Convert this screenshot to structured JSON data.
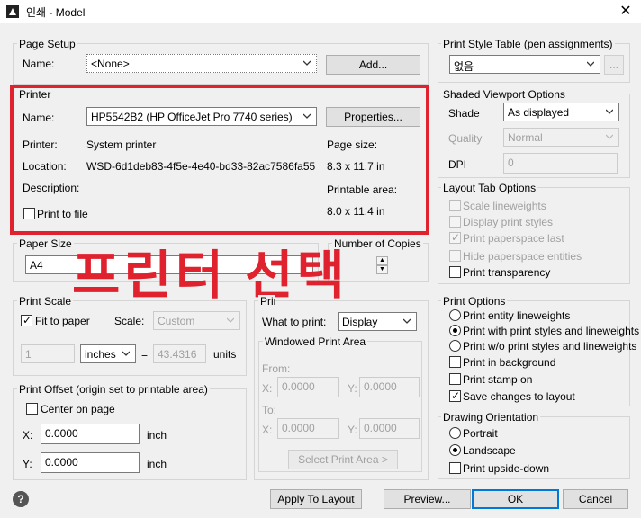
{
  "window": {
    "title": "인쇄 - Model",
    "close": "✕"
  },
  "page_setup": {
    "label": "Page Setup",
    "name_label": "Name:",
    "name_value": "<None>",
    "add_button": "Add..."
  },
  "printer": {
    "label": "Printer",
    "name_label": "Name:",
    "name_value": "HP5542B2 (HP OfficeJet Pro 7740 series)",
    "properties_button": "Properties...",
    "printer_label": "Printer:",
    "printer_value": "System printer",
    "location_label": "Location:",
    "location_value": "WSD-6d1deb83-4f5e-4e40-bd33-82ac7586fa55",
    "description_label": "Description:",
    "print_to_file": "Print to file",
    "page_size_label": "Page size:",
    "page_size_value": "8.3 x 11.7 in",
    "printable_area_label": "Printable area:",
    "printable_area_value": "8.0 x 11.4 in"
  },
  "annotation": "프린터 선택",
  "paper_size": {
    "label": "Paper Size",
    "value": "A4"
  },
  "copies": {
    "label": "Number of Copies"
  },
  "print_scale": {
    "label": "Print Scale",
    "fit_to_paper": "Fit to paper",
    "fit_checked": true,
    "scale_label": "Scale:",
    "scale_value": "Custom",
    "num1": "1",
    "unit": "inches",
    "equals": "=",
    "num2": "43.4316",
    "units_label": "units"
  },
  "print_area": {
    "label": "Print area",
    "what_label": "What to print:",
    "what_value": "Display",
    "windowed_label": "Windowed Print Area",
    "from_label": "From:",
    "to_label": "To:",
    "x_label": "X:",
    "y_label": "Y:",
    "from_x": "0.0000",
    "from_y": "0.0000",
    "to_x": "0.0000",
    "to_y": "0.0000",
    "select_button": "Select Print Area >"
  },
  "print_offset": {
    "label": "Print Offset (origin set to printable area)",
    "center": "Center on page",
    "x_label": "X:",
    "x_value": "0.0000",
    "x_unit": "inch",
    "y_label": "Y:",
    "y_value": "0.0000",
    "y_unit": "inch"
  },
  "style_table": {
    "label": "Print Style Table (pen assignments)",
    "value": "없음",
    "edit_button": "..."
  },
  "shaded": {
    "label": "Shaded Viewport Options",
    "shade_label": "Shade",
    "shade_value": "As displayed",
    "quality_label": "Quality",
    "quality_value": "Normal",
    "dpi_label": "DPI",
    "dpi_value": "0"
  },
  "layout_tab": {
    "label": "Layout Tab Options",
    "scale_lineweights": "Scale lineweights",
    "display_print_styles": "Display print styles",
    "print_paperspace_last": "Print paperspace last",
    "hide_paperspace_entities": "Hide paperspace entities",
    "print_transparency": "Print transparency"
  },
  "print_options": {
    "label": "Print Options",
    "entity_lineweights": "Print entity lineweights",
    "with_styles": "Print with print styles and lineweights",
    "wo_styles": "Print w/o print styles and lineweights",
    "in_background": "Print in background",
    "stamp_on": "Print stamp on",
    "save_changes": "Save changes to layout"
  },
  "orientation": {
    "label": "Drawing Orientation",
    "portrait": "Portrait",
    "landscape": "Landscape",
    "upside_down": "Print upside-down"
  },
  "footer": {
    "help": "?",
    "apply": "Apply To Layout",
    "preview": "Preview...",
    "ok": "OK",
    "cancel": "Cancel"
  },
  "colors": {
    "accent": "#0078d7",
    "annotation_red": "#e0212e",
    "dialog_bg": "#f0f0f0"
  }
}
